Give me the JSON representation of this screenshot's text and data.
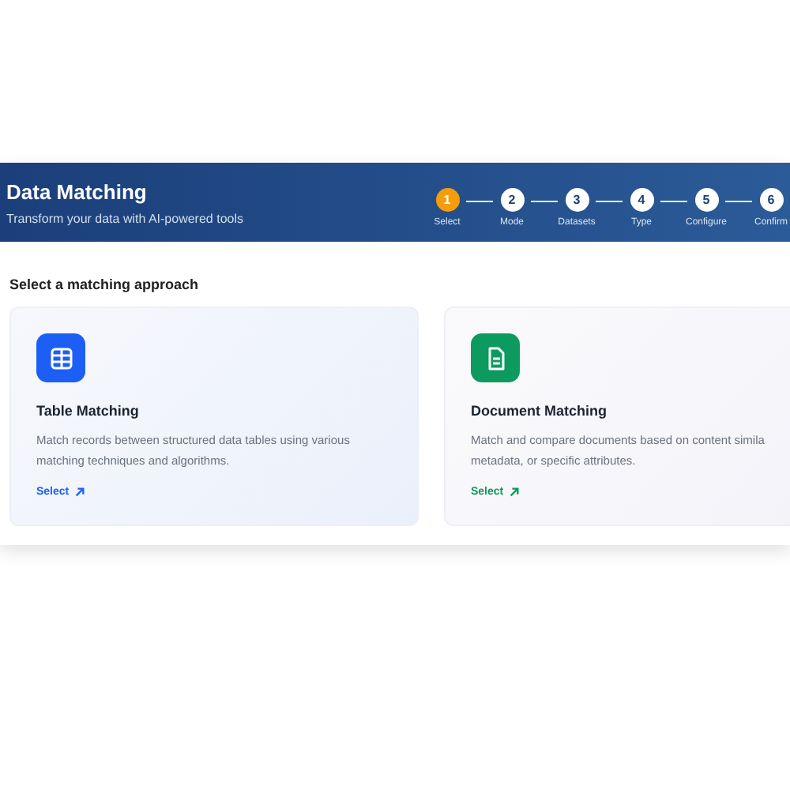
{
  "header": {
    "title": "Data Matching",
    "subtitle": "Transform your data with AI-powered tools"
  },
  "steps": [
    {
      "number": "1",
      "label": "Select",
      "selected": true
    },
    {
      "number": "2",
      "label": "Mode",
      "selected": false
    },
    {
      "number": "3",
      "label": "Datasets",
      "selected": false
    },
    {
      "number": "4",
      "label": "Type",
      "selected": false
    },
    {
      "number": "5",
      "label": "Configure",
      "selected": false
    },
    {
      "number": "6",
      "label": "Confirm",
      "selected": false
    }
  ],
  "section_title": "Select a matching approach",
  "cards": [
    {
      "kind": "table",
      "color": "#1d5ff5",
      "title": "Table Matching",
      "description_lines": [
        "Match records between structured data tables using various",
        "matching techniques and algorithms."
      ],
      "link": "Select"
    },
    {
      "kind": "document",
      "color": "#0d9a5e",
      "title": "Document Matching",
      "description_lines": [
        "Match and compare documents based on content simila",
        "metadata, or specific attributes."
      ],
      "link": "Select"
    }
  ]
}
